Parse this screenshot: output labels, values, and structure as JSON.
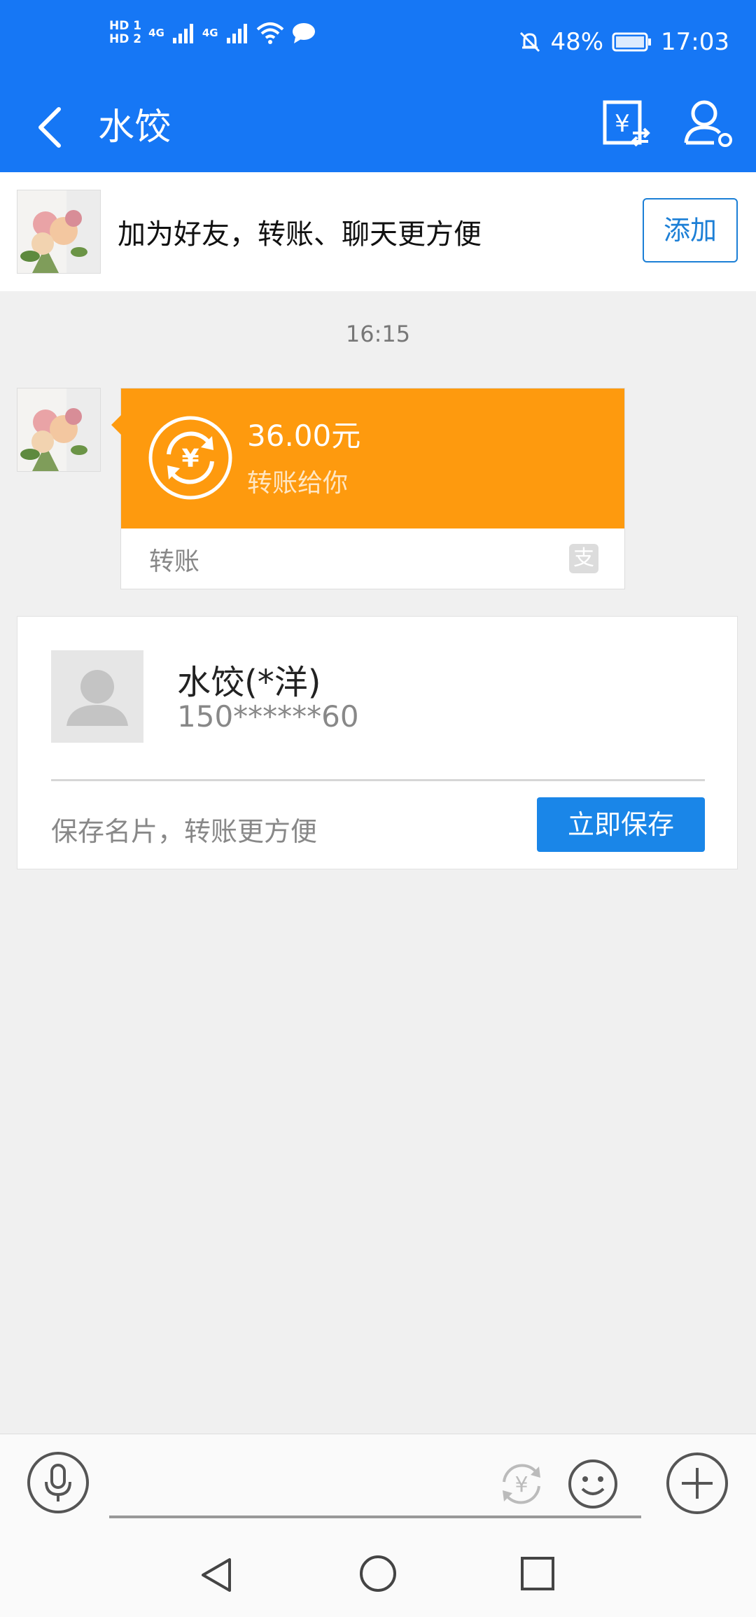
{
  "status_bar": {
    "hd1": "HD 1",
    "hd2": "HD 2",
    "net1": "4G",
    "net2": "4G",
    "battery": "48%",
    "time": "17:03"
  },
  "header": {
    "title": "水饺",
    "back_icon": "back-arrow-icon",
    "transfer_icon": "transfer-yuan-icon",
    "profile_icon": "user-settings-icon"
  },
  "banner": {
    "text": "加为好友，转账、聊天更方便",
    "add_label": "添加"
  },
  "chat": {
    "timestamp": "16:15",
    "transfer": {
      "amount": "36.00元",
      "desc": "转账给你",
      "footer_label": "转账",
      "footer_icon_char": "支"
    },
    "contact": {
      "name": "水饺(*洋)",
      "phone": "150******60",
      "save_hint": "保存名片，转账更方便",
      "save_label": "立即保存"
    }
  },
  "input_bar": {
    "placeholder": ""
  },
  "colors": {
    "brand_blue": "#1677f5",
    "transfer_orange": "#fe9a0e",
    "button_blue": "#1a86e8"
  }
}
